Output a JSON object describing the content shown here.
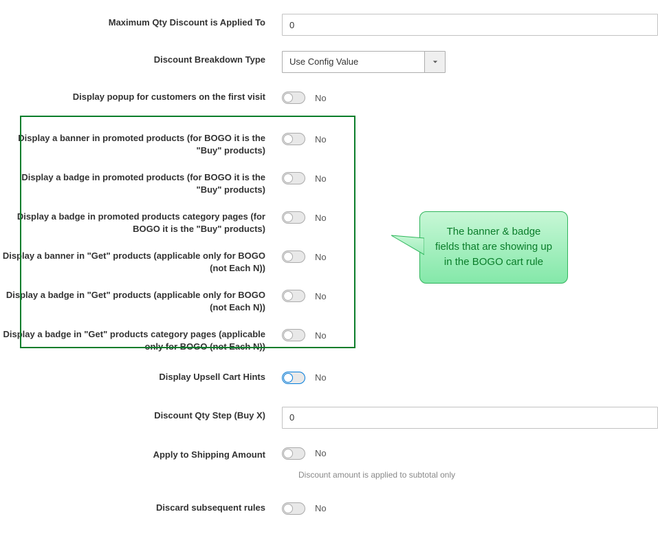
{
  "fields": {
    "max_qty": {
      "label": "Maximum Qty Discount is Applied To",
      "value": "0"
    },
    "breakdown": {
      "label": "Discount Breakdown Type",
      "value": "Use Config Value"
    },
    "popup": {
      "label": "Display popup for customers on the first visit",
      "state": "No"
    },
    "banner_promoted": {
      "label": "Display a banner in promoted products (for BOGO it is the \"Buy\" products)",
      "state": "No"
    },
    "badge_promoted": {
      "label": "Display a badge in promoted products (for BOGO it is the \"Buy\" products)",
      "state": "No"
    },
    "badge_promoted_category": {
      "label": "Display a badge in promoted products category pages (for BOGO it is the \"Buy\" products)",
      "state": "No"
    },
    "banner_get": {
      "label": "Display a banner in \"Get\" products (applicable only for BOGO (not Each N))",
      "state": "No"
    },
    "badge_get": {
      "label": "Display a badge in \"Get\" products (applicable only for BOGO (not Each N))",
      "state": "No"
    },
    "badge_get_category": {
      "label": "Display a badge in \"Get\" products category pages (applicable only for BOGO (not Each N))",
      "state": "No"
    },
    "upsell": {
      "label": "Display Upsell Cart Hints",
      "state": "No"
    },
    "qty_step": {
      "label": "Discount Qty Step (Buy X)",
      "value": "0"
    },
    "apply_shipping": {
      "label": "Apply to Shipping Amount",
      "state": "No",
      "hint": "Discount amount is applied to subtotal only"
    },
    "discard": {
      "label": "Discard subsequent rules",
      "state": "No"
    }
  },
  "callout": {
    "text": "The banner & badge fields that are showing up in the BOGO cart rule"
  }
}
